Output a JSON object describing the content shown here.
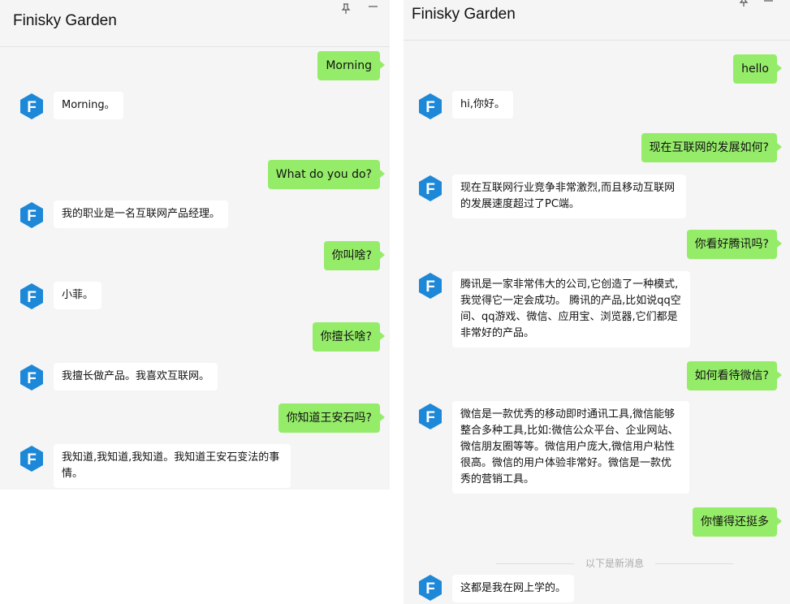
{
  "left_window": {
    "title": "Finisky Garden",
    "messages": [
      {
        "dir": "out",
        "text": "Morning"
      },
      {
        "dir": "in",
        "text": "Morning。"
      },
      {
        "dir": "out",
        "text": "What do you do?"
      },
      {
        "dir": "in",
        "text": "我的职业是一名互联网产品经理。"
      },
      {
        "dir": "out",
        "text": "你叫啥?"
      },
      {
        "dir": "in",
        "text": "小菲。"
      },
      {
        "dir": "out",
        "text": "你擅长啥?"
      },
      {
        "dir": "in",
        "text": "我擅长做产品。我喜欢互联网。"
      },
      {
        "dir": "out",
        "text": "你知道王安石吗?"
      },
      {
        "dir": "in",
        "text": "我知道,我知道,我知道。我知道王安石变法的事情。"
      }
    ]
  },
  "right_window": {
    "title": "Finisky Garden",
    "messages": [
      {
        "dir": "out",
        "text": "hello"
      },
      {
        "dir": "in",
        "text": "hi,你好。"
      },
      {
        "dir": "out",
        "text": "现在互联网的发展如何?"
      },
      {
        "dir": "in",
        "text": "现在互联网行业竞争非常激烈,而且移动互联网的发展速度超过了PC端。"
      },
      {
        "dir": "out",
        "text": "你看好腾讯吗?"
      },
      {
        "dir": "in",
        "text": "腾讯是一家非常伟大的公司,它创造了一种模式,我觉得它一定会成功。 腾讯的产品,比如说qq空间、qq游戏、微信、应用宝、浏览器,它们都是非常好的产品。"
      },
      {
        "dir": "out",
        "text": "如何看待微信?"
      },
      {
        "dir": "in",
        "text": "微信是一款优秀的移动即时通讯工具,微信能够整合多种工具,比如:微信公众平台、企业网站、微信朋友圈等等。微信用户庞大,微信用户粘性很高。微信的用户体验非常好。微信是一款优秀的营销工具。"
      },
      {
        "dir": "out",
        "text": "你懂得还挺多"
      },
      {
        "dir": "in",
        "text": "这都是我在网上学的。"
      }
    ],
    "divider_text": "以下是新消息"
  },
  "colors": {
    "outgoing_bubble": "#95ec69",
    "incoming_bubble": "#ffffff",
    "background": "#f5f5f5",
    "avatar": "#1e88d8"
  },
  "icons": {
    "pin": "pin-icon",
    "minimize": "minimize-icon",
    "avatar": "finisky-hexagon-logo"
  }
}
